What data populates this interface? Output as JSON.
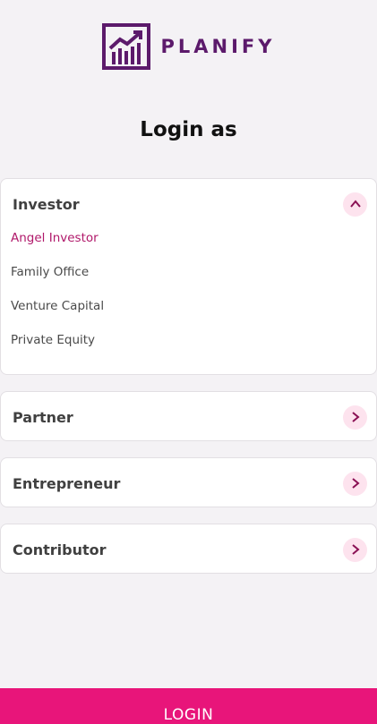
{
  "brand": {
    "name": "PLANIFY",
    "logo_icon": "growth-chart-icon",
    "color": "#5c1a6b"
  },
  "title": "Login as",
  "accent": "#e8157a",
  "groups": [
    {
      "label": "Investor",
      "expanded": true,
      "icon": "chevron-up-icon",
      "items": [
        {
          "label": "Angel Investor",
          "selected": true
        },
        {
          "label": "Family Office",
          "selected": false
        },
        {
          "label": "Venture Capital",
          "selected": false
        },
        {
          "label": "Private Equity",
          "selected": false
        }
      ]
    },
    {
      "label": "Partner",
      "expanded": false,
      "icon": "chevron-right-icon"
    },
    {
      "label": "Entrepreneur",
      "expanded": false,
      "icon": "chevron-right-icon"
    },
    {
      "label": "Contributor",
      "expanded": false,
      "icon": "chevron-right-icon"
    }
  ],
  "login_button": "LOGIN"
}
